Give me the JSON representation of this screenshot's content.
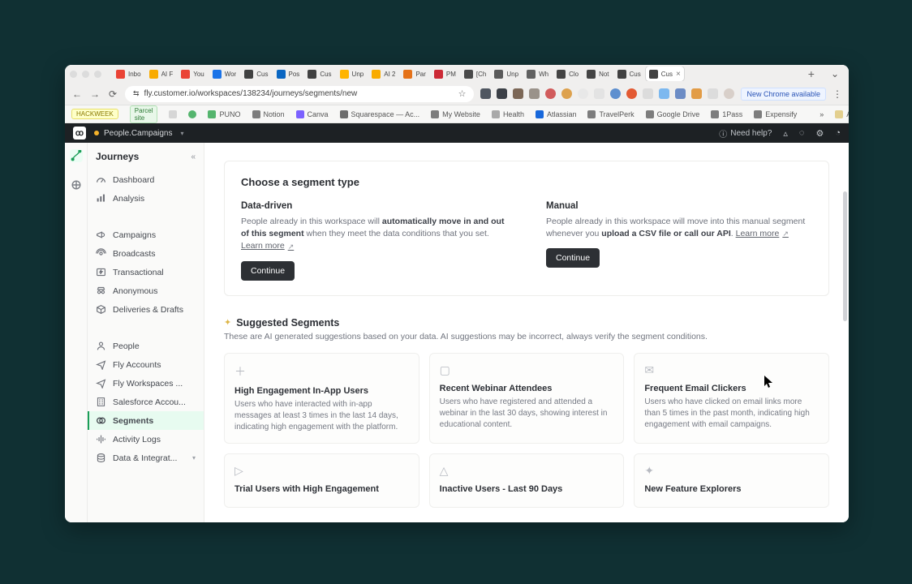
{
  "browser": {
    "url": "fly.customer.io/workspaces/138234/journeys/segments/new",
    "chrome_update": "New Chrome available",
    "tabs": [
      {
        "title": "Inbo",
        "fav": "#ea4335"
      },
      {
        "title": "AI F",
        "fav": "#f9ab00"
      },
      {
        "title": "You",
        "fav": "#ea4335"
      },
      {
        "title": "Wor",
        "fav": "#1a73e8"
      },
      {
        "title": "Cus",
        "fav": "#414141"
      },
      {
        "title": "Pos",
        "fav": "#0a66c2"
      },
      {
        "title": "Cus",
        "fav": "#414141"
      },
      {
        "title": "Unp",
        "fav": "#ffb400"
      },
      {
        "title": "AI 2",
        "fav": "#f9ab00"
      },
      {
        "title": "Par",
        "fav": "#e57219"
      },
      {
        "title": "PM",
        "fav": "#cc2a36"
      },
      {
        "title": "[Ch",
        "fav": "#4a4a4a"
      },
      {
        "title": "Unp",
        "fav": "#5a5a5a"
      },
      {
        "title": "Wh",
        "fav": "#606060"
      },
      {
        "title": "Clo",
        "fav": "#444"
      },
      {
        "title": "Not",
        "fav": "#444"
      },
      {
        "title": "Cus",
        "fav": "#414141"
      },
      {
        "title": "Cus",
        "fav": "#414141",
        "active": true
      }
    ],
    "bookmarks": {
      "hackweek": "HACKWEEK",
      "parcel": "Parcel site",
      "items": [
        {
          "label": "PUNO",
          "color": "#55b56e"
        },
        {
          "label": "Notion",
          "color": "#7d7d7d"
        },
        {
          "label": "Canva",
          "color": "#7b61ff"
        },
        {
          "label": "Squarespace — Ac...",
          "color": "#6d6d6d"
        },
        {
          "label": "My Website",
          "color": "#7d7d7d"
        },
        {
          "label": "Health",
          "color": "#a9a9a9"
        },
        {
          "label": "Atlassian",
          "color": "#1868db"
        },
        {
          "label": "TravelPerk",
          "color": "#7d7d7d"
        },
        {
          "label": "Google Drive",
          "color": "#7d7d7d"
        },
        {
          "label": "1Pass",
          "color": "#7d7d7d"
        },
        {
          "label": "Expensify",
          "color": "#7d7d7d"
        }
      ],
      "overflow": "»",
      "all": "All Bookmarks"
    }
  },
  "app": {
    "workspace": "People.Campaigns",
    "need_help": "Need help?"
  },
  "sidebar": {
    "title": "Journeys",
    "items": [
      {
        "icon": "speedometer",
        "label": "Dashboard"
      },
      {
        "icon": "bars",
        "label": "Analysis"
      },
      {
        "icon": "megaphone",
        "label": "Campaigns"
      },
      {
        "icon": "broadcast",
        "label": "Broadcasts"
      },
      {
        "icon": "bolt",
        "label": "Transactional"
      },
      {
        "icon": "anon",
        "label": "Anonymous"
      },
      {
        "icon": "box",
        "label": "Deliveries & Drafts"
      },
      {
        "icon": "person",
        "label": "People"
      },
      {
        "icon": "send",
        "label": "Fly Accounts"
      },
      {
        "icon": "send",
        "label": "Fly Workspaces ..."
      },
      {
        "icon": "building",
        "label": "Salesforce Accou..."
      },
      {
        "icon": "circles",
        "label": "Segments",
        "active": true
      },
      {
        "icon": "pulse",
        "label": "Activity Logs"
      },
      {
        "icon": "db",
        "label": "Data & Integrat...",
        "caret": true
      }
    ]
  },
  "main": {
    "choose": {
      "title": "Choose a segment type",
      "data_driven": {
        "title": "Data-driven",
        "lead": "People already in this workspace will ",
        "bold": "automatically move in and out of this segment",
        "tail": " when they meet the data conditions that you set. ",
        "learn": "Learn more",
        "cta": "Continue"
      },
      "manual": {
        "title": "Manual",
        "lead": "People already in this workspace will move into this manual segment whenever you ",
        "bold": "upload a CSV file or call our API",
        "tail": ". ",
        "learn": "Learn more",
        "cta": "Continue"
      }
    },
    "suggested": {
      "title": "Suggested Segments",
      "sub": "These are AI generated suggestions based on your data. AI suggestions may be incorrect, always verify the segment conditions.",
      "tiles": [
        {
          "title": "High Engagement In-App Users",
          "desc": "Users who have interacted with in-app messages at least 3 times in the last 14 days, indicating high engagement with the platform."
        },
        {
          "title": "Recent Webinar Attendees",
          "desc": "Users who have registered and attended a webinar in the last 30 days, showing interest in educational content."
        },
        {
          "title": "Frequent Email Clickers",
          "desc": "Users who have clicked on email links more than 5 times in the past month, indicating high engagement with email campaigns."
        },
        {
          "title": "Trial Users with High Engagement",
          "desc": ""
        },
        {
          "title": "Inactive Users - Last 90 Days",
          "desc": ""
        },
        {
          "title": "New Feature Explorers",
          "desc": ""
        }
      ]
    }
  }
}
